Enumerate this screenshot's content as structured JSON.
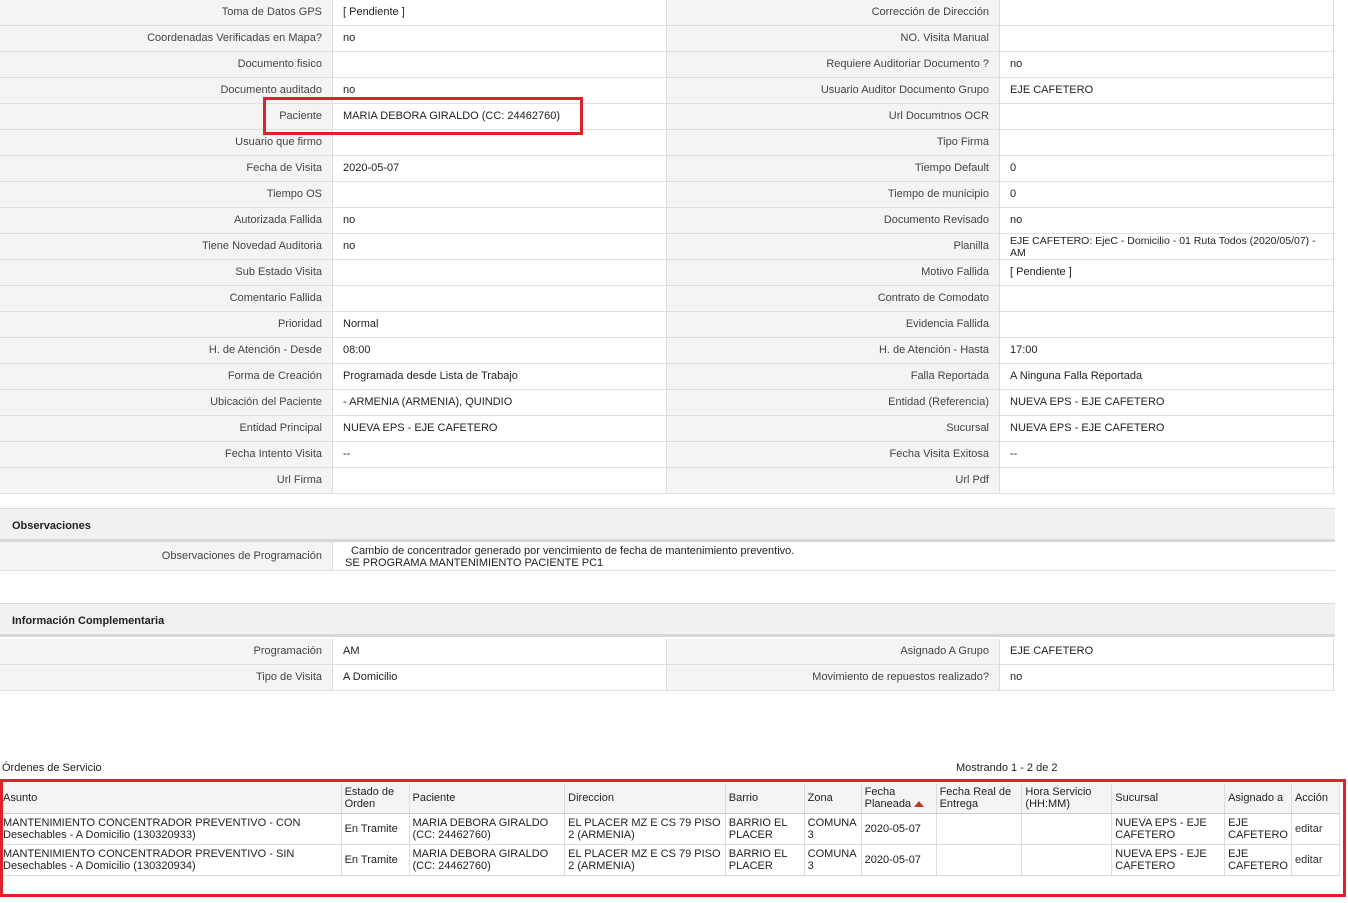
{
  "details": [
    {
      "l1": "Toma de Datos GPS",
      "v1": "[ Pendiente ]",
      "l2": "Corrección de Dirección",
      "v2": ""
    },
    {
      "l1": "Coordenadas Verificadas en Mapa?",
      "v1": "no",
      "l2": "NO. Visita Manual",
      "v2": ""
    },
    {
      "l1": "Documento fisico",
      "v1": "",
      "l2": "Requiere Auditoriar Documento ?",
      "v2": "no"
    },
    {
      "l1": "Documento auditado",
      "v1": "no",
      "l2": "Usuario Auditor Documento Grupo",
      "v2": "EJE CAFETERO"
    },
    {
      "l1": "Paciente",
      "v1": "MARIA DEBORA GIRALDO (CC: 24462760)",
      "l2": "Url Documtnos OCR",
      "v2": ""
    },
    {
      "l1": "Usuario que firmo",
      "v1": "",
      "l2": "Tipo Firma",
      "v2": ""
    },
    {
      "l1": "Fecha de Visita",
      "v1": "2020-05-07",
      "l2": "Tiempo Default",
      "v2": "0"
    },
    {
      "l1": "Tiempo OS",
      "v1": "",
      "l2": "Tiempo de municipio",
      "v2": "0"
    },
    {
      "l1": "Autorizada Fallida",
      "v1": "no",
      "l2": "Documento Revisado",
      "v2": "no"
    },
    {
      "l1": "Tiene Novedad Auditoria",
      "v1": "no",
      "l2": "Planilla",
      "v2": "EJE CAFETERO: EjeC - Domicilio - 01 Ruta Todos (2020/05/07) - AM"
    },
    {
      "l1": "Sub Estado Visita",
      "v1": "",
      "l2": "Motivo Fallida",
      "v2": "[ Pendiente ]"
    },
    {
      "l1": "Comentario Fallida",
      "v1": "",
      "l2": "Contrato de Comodato",
      "v2": ""
    },
    {
      "l1": "Prioridad",
      "v1": "Normal",
      "l2": "Evidencia Fallida",
      "v2": ""
    },
    {
      "l1": "H. de Atención - Desde",
      "v1": "08:00",
      "l2": "H. de Atención - Hasta",
      "v2": "17:00"
    },
    {
      "l1": "Forma de Creación",
      "v1": "Programada desde Lista de Trabajo",
      "l2": "Falla Reportada",
      "v2": "A Ninguna Falla Reportada"
    },
    {
      "l1": "Ubicación del Paciente",
      "v1": "- ARMENIA (ARMENIA), QUINDIO",
      "l2": "Entidad (Referencia)",
      "v2": "NUEVA EPS - EJE CAFETERO"
    },
    {
      "l1": "Entidad Principal",
      "v1": "NUEVA EPS - EJE CAFETERO",
      "l2": "Sucursal",
      "v2": "NUEVA EPS - EJE CAFETERO"
    },
    {
      "l1": "Fecha Intento Visita",
      "v1": "--",
      "l2": "Fecha Visita Exitosa",
      "v2": "--"
    },
    {
      "l1": "Url Firma",
      "v1": "",
      "l2": "Url Pdf",
      "v2": ""
    }
  ],
  "observaciones": {
    "title": "Observaciones",
    "label": "Observaciones de Programación",
    "line1": "Cambio de concentrador generado por vencimiento de fecha de mantenimiento preventivo.",
    "line2": "SE PROGRAMA MANTENIMIENTO PACIENTE PC1"
  },
  "complementaria": {
    "title": "Información Complementaria",
    "rows": [
      {
        "l1": "Programación",
        "v1": "AM",
        "l2": "Asignado A Grupo",
        "v2": "EJE CAFETERO"
      },
      {
        "l1": "Tipo de Visita",
        "v1": "A Domicilio",
        "l2": "Movimiento de repuestos realizado?",
        "v2": "no"
      }
    ]
  },
  "orders": {
    "title": "Órdenes de Servicio",
    "showing": "Mostrando 1 - 2 de 2",
    "headers": [
      "Asunto",
      "Estado de Orden",
      "Paciente",
      "Direccion",
      "Barrio",
      "Zona",
      "Fecha Planeada",
      "Fecha Real de Entrega",
      "Hora Servicio (HH:MM)",
      "Sucursal",
      "Asignado a",
      "Acción"
    ],
    "rows": [
      [
        "MANTENIMIENTO CONCENTRADOR PREVENTIVO - CON Desechables - A Domicilio (130320933)",
        "En Tramite",
        "MARIA DEBORA GIRALDO (CC: 24462760)",
        "EL PLACER MZ E CS 79 PISO 2 (ARMENIA)",
        "BARRIO EL PLACER",
        "COMUNA 3",
        "2020-05-07",
        "",
        "",
        "NUEVA EPS - EJE CAFETERO",
        "EJE CAFETERO",
        "editar"
      ],
      [
        "MANTENIMIENTO CONCENTRADOR PREVENTIVO - SIN Desechables - A Domicilio (130320934)",
        "En Tramite",
        "MARIA DEBORA GIRALDO (CC: 24462760)",
        "EL PLACER MZ E CS 79 PISO 2 (ARMENIA)",
        "BARRIO EL PLACER",
        "COMUNA 3",
        "2020-05-07",
        "",
        "",
        "NUEVA EPS - EJE CAFETERO",
        "EJE CAFETERO",
        "editar"
      ]
    ]
  },
  "colors": {
    "highlight": "#e0212b",
    "sort_arrow": "#c0392b"
  }
}
